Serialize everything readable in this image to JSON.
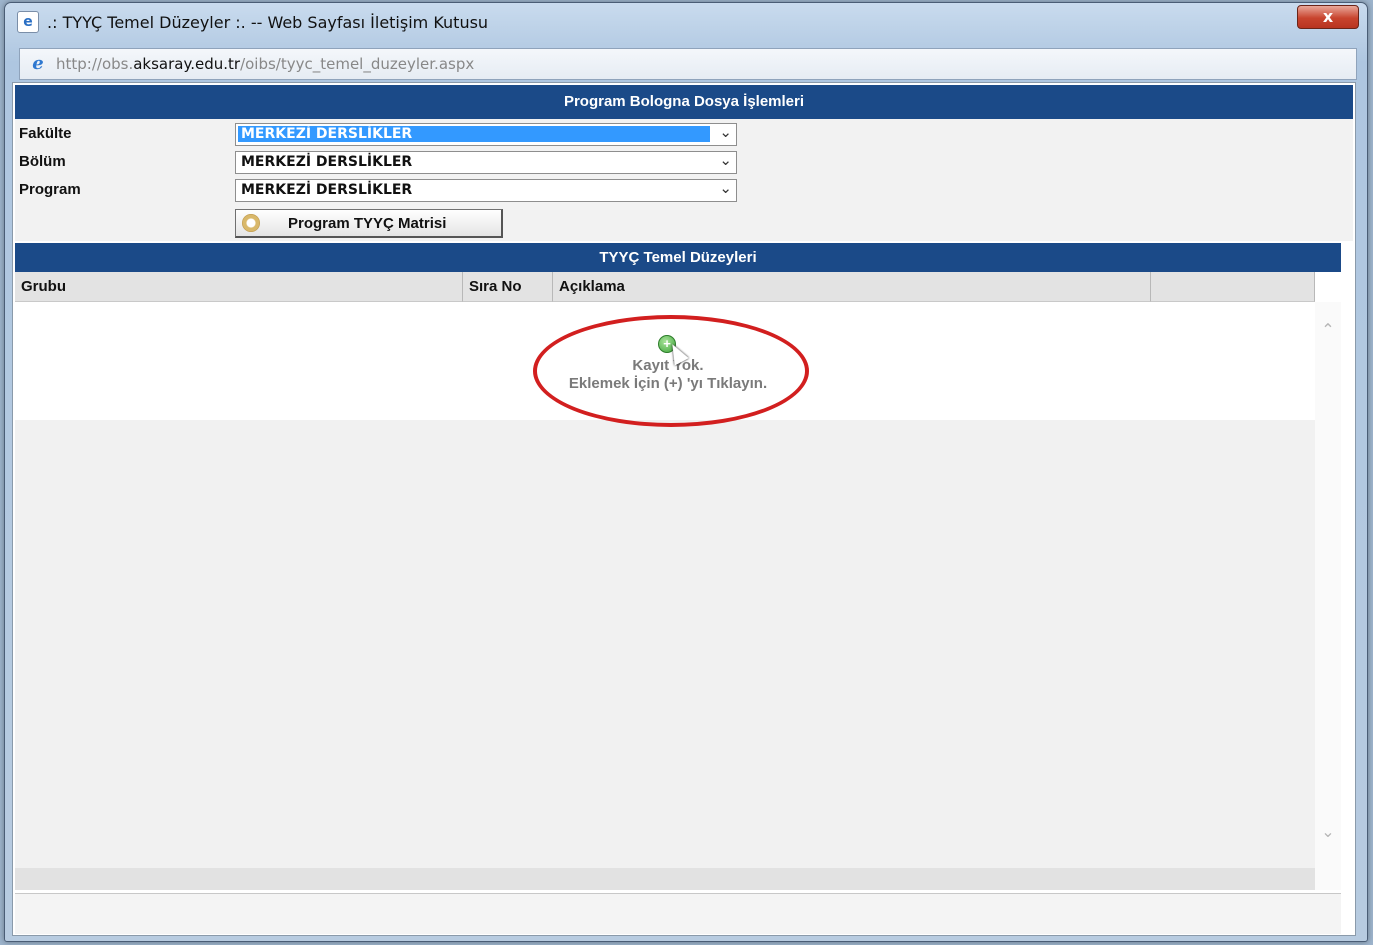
{
  "window": {
    "title": ".: TYYÇ Temel Düzeyler :. -- Web Sayfası İletişim Kutusu",
    "close_label": "x",
    "url_prefix": "http://obs.",
    "url_domain": "aksaray.edu.tr",
    "url_path": "/oibs/tyyc_temel_duzeyler.aspx"
  },
  "header": {
    "title": "Program Bologna Dosya İşlemleri"
  },
  "form": {
    "faculty_label": "Fakülte",
    "faculty_value": "MERKEZİ DERSLİKLER",
    "department_label": "Bölüm",
    "department_value": "MERKEZİ DERSLİKLER",
    "program_label": "Program",
    "program_value": "MERKEZİ DERSLİKLER",
    "matrix_button": "Program TYYÇ Matrisi"
  },
  "grid": {
    "title": "TYYÇ Temel Düzeyleri",
    "columns": [
      "Grubu",
      "Sıra No",
      "Açıklama",
      ""
    ],
    "empty_line1": "Kayıt Yok.",
    "empty_line2": "Eklemek İçin (+) 'yı Tıklayın.",
    "add_symbol": "+"
  },
  "colors": {
    "header_bg": "#1b4a88",
    "highlight": "#3399ff",
    "annotation": "#d21f1f"
  },
  "icons": [
    "ie-page-icon",
    "close-icon",
    "ie-icon",
    "chevron-down-icon",
    "gear-icon",
    "add-icon",
    "cursor-icon",
    "chevron-up-icon"
  ]
}
